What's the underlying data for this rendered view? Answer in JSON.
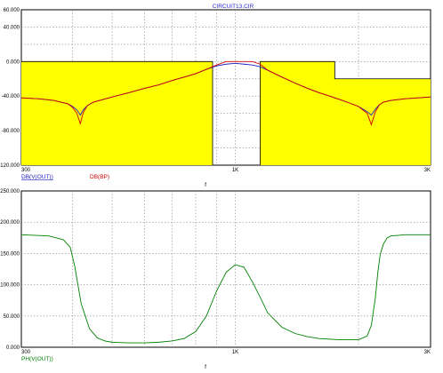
{
  "window_title": "CIRCUIT13.CIR",
  "chart_data": [
    {
      "type": "line",
      "title": "CIRCUIT13.CIR",
      "xlabel": "f",
      "x_scale": "log",
      "xlim": [
        300,
        3000
      ],
      "x_tick_labels": [
        "300",
        "1K",
        "3K"
      ],
      "ylim": [
        -120,
        60
      ],
      "y_tick_labels": [
        "60.000",
        "40.000",
        "0.000",
        "-40.000",
        "-80.000",
        "-120.000"
      ],
      "grid": true,
      "series": [
        {
          "name": "DB(BP)",
          "color": "#d00000",
          "kind": "filled-step",
          "fill_color": "#ffff00",
          "x": [
            300,
            880,
            880,
            1150,
            1150,
            1750,
            1750,
            3000
          ],
          "y": [
            0,
            0,
            -120,
            -120,
            0,
            0,
            -20,
            -20
          ]
        },
        {
          "name": "DB(V(OUT))",
          "color": "#2020c0",
          "x": [
            300,
            330,
            360,
            390,
            400,
            410,
            418,
            425,
            435,
            450,
            500,
            550,
            600,
            650,
            700,
            750,
            800,
            850,
            900,
            950,
            1000,
            1050,
            1100,
            1150,
            1200,
            1300,
            1400,
            1500,
            1600,
            1700,
            1800,
            1900,
            2000,
            2100,
            2150,
            2200,
            2250,
            2300,
            2400,
            2600,
            2800,
            3000
          ],
          "y": [
            -42,
            -43,
            -45,
            -49,
            -52,
            -56,
            -62,
            -56,
            -51,
            -47,
            -41,
            -36,
            -31,
            -27,
            -22,
            -18,
            -14,
            -9,
            -5,
            -3,
            -2,
            -3,
            -4,
            -6,
            -10,
            -18,
            -25,
            -31,
            -36,
            -40,
            -44,
            -48,
            -52,
            -58,
            -62,
            -55,
            -50,
            -47,
            -45,
            -43,
            -42,
            -41
          ]
        },
        {
          "name": "DB(V(OUT)) red",
          "color": "#d00000",
          "x": [
            300,
            330,
            360,
            390,
            400,
            410,
            418,
            425,
            435,
            450,
            500,
            550,
            600,
            650,
            700,
            750,
            800,
            850,
            900,
            950,
            1000,
            1050,
            1100,
            1150,
            1200,
            1300,
            1400,
            1500,
            1600,
            1700,
            1800,
            1900,
            2000,
            2100,
            2150,
            2200,
            2250,
            2300,
            2400,
            2600,
            2800,
            3000
          ],
          "y": [
            -42,
            -43,
            -45,
            -49,
            -53,
            -60,
            -72,
            -59,
            -51,
            -47,
            -41,
            -36,
            -31,
            -27,
            -22,
            -18,
            -14,
            -9,
            -4,
            0,
            0,
            0,
            0,
            -3,
            -10,
            -18,
            -25,
            -31,
            -36,
            -40,
            -44,
            -48,
            -52,
            -60,
            -73,
            -58,
            -50,
            -47,
            -45,
            -43,
            -42,
            -41
          ]
        }
      ],
      "legend": [
        "DB(V(OUT))",
        "DB(BP)"
      ]
    },
    {
      "type": "line",
      "xlabel": "f",
      "x_scale": "log",
      "xlim": [
        300,
        3000
      ],
      "x_tick_labels": [
        "300",
        "1K",
        "3K"
      ],
      "ylim": [
        0,
        250
      ],
      "y_tick_labels": [
        "250.000",
        "200.000",
        "150.000",
        "100.000",
        "50.000",
        "0.000"
      ],
      "grid": true,
      "series": [
        {
          "name": "PH(V(OUT))",
          "color": "#008000",
          "x": [
            300,
            350,
            380,
            395,
            405,
            420,
            440,
            460,
            480,
            500,
            550,
            600,
            650,
            700,
            750,
            800,
            850,
            900,
            950,
            1000,
            1050,
            1100,
            1150,
            1200,
            1300,
            1400,
            1500,
            1600,
            1800,
            2000,
            2100,
            2150,
            2200,
            2230,
            2260,
            2300,
            2350,
            2400,
            2600,
            2800,
            3000
          ],
          "y": [
            180,
            178,
            172,
            160,
            130,
            70,
            30,
            15,
            10,
            8,
            7,
            7,
            8,
            10,
            14,
            25,
            50,
            90,
            120,
            132,
            128,
            105,
            80,
            55,
            32,
            22,
            17,
            14,
            12,
            12,
            18,
            35,
            80,
            120,
            148,
            165,
            175,
            178,
            180,
            180,
            180
          ]
        }
      ],
      "legend": [
        "PH(V(OUT))"
      ]
    }
  ]
}
